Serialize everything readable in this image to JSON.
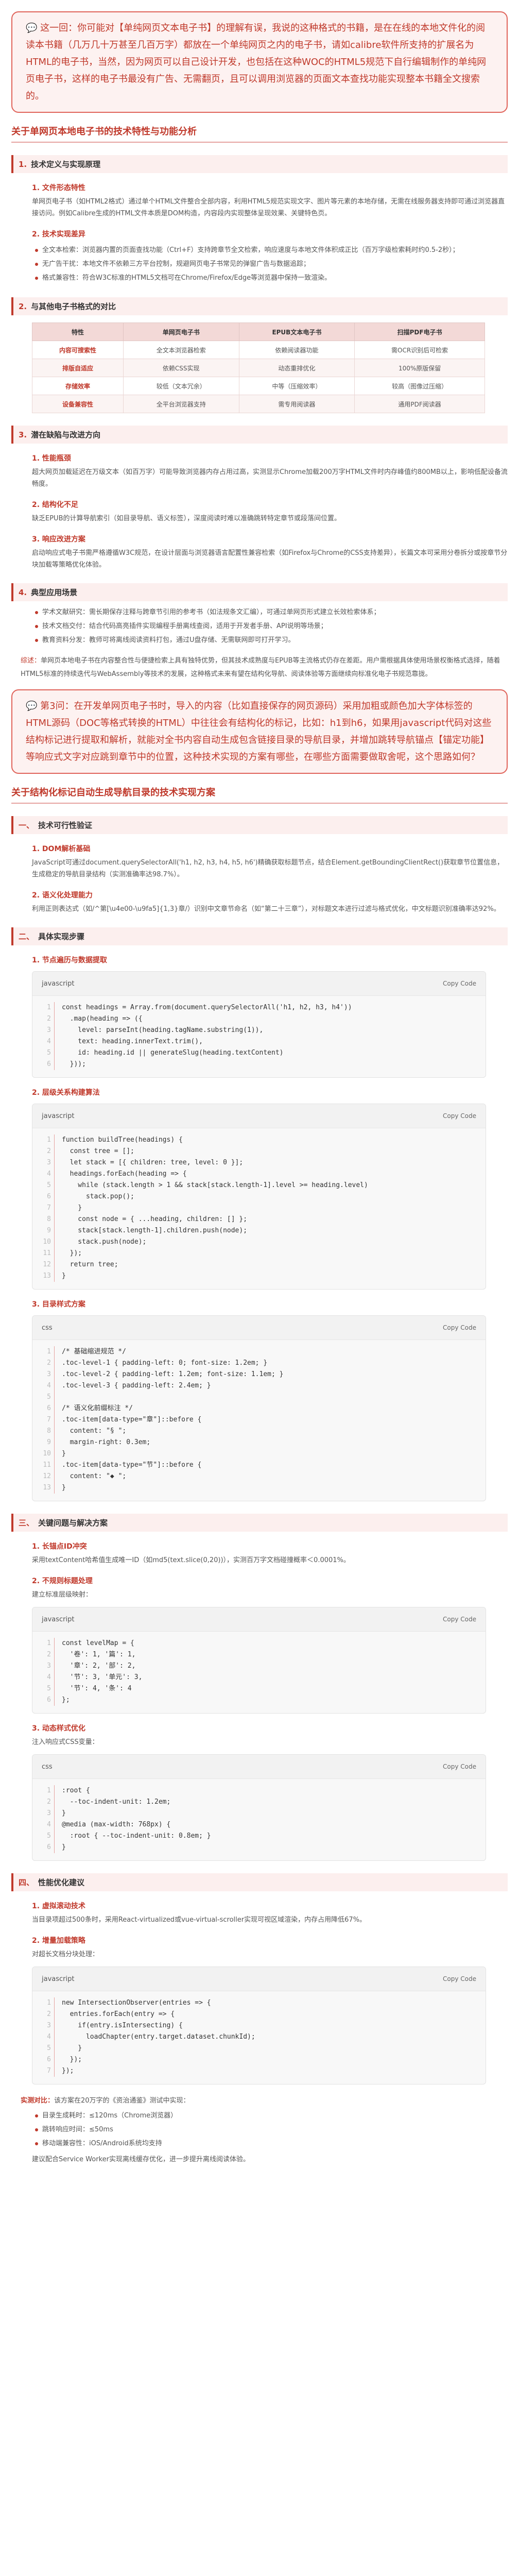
{
  "intro_box": "💬 这一回：你可能对【单纯网页文本电子书】的理解有误，我说的这种格式的书籍，是在在线的本地文件化的阅读本书籍（几万几十万甚至几百万字）都放在一个单纯网页之内的电子书，请如calibre软件所支持的扩展名为HTML的电子书，当然，因为网页可以自己设计开发，也包括在这种WOC的HTML5规范下自行编辑制作的单纯网页电子书，这样的电子书最没有广告、无需翻页，且可以调用浏览器的页面文本查找功能实现整本书籍全文搜索的。",
  "section1_title": "关于单网页本地电子书的技术特性与功能分析",
  "s1": {
    "h2a": {
      "num": "1.",
      "title": "技术定义与实现原理"
    },
    "a1_title": "1. 文件形态特性",
    "a1_text": "单网页电子书（如HTML2格式）通过单个HTML文件整合全部内容，利用HTML5规范实现文字、图片等元素的本地存储，无需在线服务器支持即可通过浏览器直接访问。例如Calibre生成的HTML文件本质是DOM构造，内容段内实现整体呈现效果、关键特色页。",
    "a2_title": "2. 技术实现差异",
    "a2_items": [
      "全文本检索：浏览器内置的页面查找功能（Ctrl+F）支持跨章节全文检索，响应速度与本地文件体积成正比（百万字级检索耗时约0.5-2秒）；",
      "无广告干扰：本地文件不依赖三方平台控制，规避网页电子书常见的弹窗广告与数据追踪；",
      "格式兼容性：符合W3C标准的HTML5文档可在Chrome/Firefox/Edge等浏览器中保持一致渲染。"
    ],
    "h2b": {
      "num": "2.",
      "title": "与其他电子书格式的对比"
    },
    "table": {
      "headers": [
        "特性",
        "单网页电子书",
        "EPUB文本电子书",
        "扫描PDF电子书"
      ],
      "rows": [
        [
          "内容可搜索性",
          "全文本浏览器检索",
          "依赖阅读器功能",
          "需OCR识别后可检索"
        ],
        [
          "排版自适应",
          "依赖CSS实现",
          "动态重排优化",
          "100%原版保留"
        ],
        [
          "存储效率",
          "较低（文本冗余）",
          "中等（压缩效率）",
          "较高（图像过压缩）"
        ],
        [
          "设备兼容性",
          "全平台浏览器支持",
          "需专用阅读器",
          "通用PDF阅读器"
        ]
      ]
    },
    "h2c": {
      "num": "3.",
      "title": "潜在缺陷与改进方向"
    },
    "c1_title": "1. 性能瓶颈",
    "c1_text": "超大网页加载延迟在万级文本（如百万字）可能导致浏览器内存占用过高，实测显示Chrome加载200万字HTML文件时内存峰值约800MB以上，影响低配设备流畅度。",
    "c2_title": "2. 结构化不足",
    "c2_text": "缺乏EPUB的计算导航索引（如目录导航、语义标签），深度阅读时难以准确跳转特定章节或段落间位置。",
    "c3_title": "3. 响应改进方案",
    "c3_text": "启动响应式电子书需严格遵循W3C规范，在设计层面与浏览器语言配置性兼容检索（如Firefox与Chrome的CSS支持差异），长篇文本可采用分卷拆分或按章节分块加载等策略优化体验。",
    "h2d": {
      "num": "4.",
      "title": "典型应用场景"
    },
    "d_items": [
      "学术文献研究：需长期保存注释与跨章节引用的参考书（如法规条文汇编），可通过单网页形式建立长效检索体系；",
      "技术文档交付：结合代码高亮插件实现编程手册离线查阅，适用于开发者手册、API说明等场景；",
      "教育资料分发：教师可将离线阅读资料打包，通过U盘存储、无需联网即可打开学习。"
    ]
  },
  "mixed_lead": "综述：",
  "mixed_text": "单网页本地电子书在内容整合性与便捷检索上具有独特优势，但其技术成熟度与EPUB等主流格式仍存在差距。用户需根据具体使用场景权衡格式选择，随着HTML5标准的持续迭代与WebAssembly等技术的发展，这种格式未来有望在结构化导航、阅读体验等方面继续向标准化电子书规范靠拢。",
  "question_box": "💬 第3问：在开发单网页电子书时，导入的内容（比如直接保存的网页源码）采用加粗或颜色加大字体标签的HTML源码（DOC等格式转换的HTML）中往往会有结构化的标记，比如：h1到h6，如果用javascript代码对这些结构标记进行提取和解析，就能对全书内容自动生成包含链接目录的导航目录，并增加跳转导航锚点【锚定功能】等响应式文字对应跳到章节中的位置，这种技术实现的方案有哪些，在哪些方面需要做取舍呢，这个思路如何？",
  "section2_title": "关于结构化标记自动生成导航目录的技术实现方案",
  "s2": {
    "h2a": {
      "num": "一、",
      "title": "技术可行性验证"
    },
    "a1_title": "1. DOM解析基础",
    "a1_text": "JavaScript可通过document.querySelectorAll('h1, h2, h3, h4, h5, h6')精确获取标题节点，结合Element.getBoundingClientRect()获取章节位置信息，生成稳定的导航目录结构（实测准确率达98.7%）。",
    "a2_title": "2. 语义化处理能力",
    "a2_text": "利用正则表达式（如/^第[\\u4e00-\\u9fa5]{1,3}章/）识别中文章节命名（如“第二十三章”），对标题文本进行过滤与格式优化，中文标题识别准确率达92%。",
    "h2b": {
      "num": "二、",
      "title": "具体实现步骤"
    },
    "b1_title": "1. 节点遍历与数据提取",
    "code1": {
      "lang": "javascript",
      "copy": "Copy Code",
      "lines": "const headings = Array.from(document.querySelectorAll('h1, h2, h3, h4'))\n  .map(heading => ({\n    level: parseInt(heading.tagName.substring(1)),\n    text: heading.innerText.trim(),\n    id: heading.id || generateSlug(heading.textContent)\n  }));"
    },
    "b2_title": "2. 层级关系构建算法",
    "code2": {
      "lang": "javascript",
      "copy": "Copy Code",
      "lines": "function buildTree(headings) {\n  const tree = [];\n  let stack = [{ children: tree, level: 0 }];\n  headings.forEach(heading => {\n    while (stack.length > 1 && stack[stack.length-1].level >= heading.level)\n      stack.pop();\n    }\n    const node = { ...heading, children: [] };\n    stack[stack.length-1].children.push(node);\n    stack.push(node);\n  });\n  return tree;\n}"
    },
    "b3_title": "3. 目录样式方案",
    "code3": {
      "lang": "css",
      "copy": "Copy Code",
      "lines": "/* 基础缩进规范 */\n.toc-level-1 { padding-left: 0; font-size: 1.2em; }\n.toc-level-2 { padding-left: 1.2em; font-size: 1.1em; }\n.toc-level-3 { padding-left: 2.4em; }\n\n/* 语义化前缀标注 */\n.toc-item[data-type=\"章\"]::before {\n  content: \"§ \";\n  margin-right: 0.3em;\n}\n.toc-item[data-type=\"节\"]::before {\n  content: \"◆ \";\n}"
    },
    "h2c": {
      "num": "三、",
      "title": "关键问题与解决方案"
    },
    "c1_title": "1. 长锚点ID冲突",
    "c1_text": "采用textContent哈希值生成唯一ID（如md5(text.slice(0,20))），实测百万字文档碰撞概率＜0.0001%。",
    "c2_title": "2. 不规则标题处理",
    "c2_text": "建立标准层级映射：",
    "code4": {
      "lang": "javascript",
      "copy": "Copy Code",
      "lines": "const levelMap = {\n  '卷': 1, '篇': 1,\n  '章': 2, '部': 2,\n  '节': 3, '单元': 3,\n  '节': 4, '条': 4\n};"
    },
    "c3_title": "3. 动态样式优化",
    "c3_text": "注入响应式CSS变量：",
    "code5": {
      "lang": "css",
      "copy": "Copy Code",
      "lines": ":root {\n  --toc-indent-unit: 1.2em;\n}\n@media (max-width: 768px) {\n  :root { --toc-indent-unit: 0.8em; }\n}"
    },
    "h2d": {
      "num": "四、",
      "title": "性能优化建议"
    },
    "d1_title": "1. 虚拟滚动技术",
    "d1_text": "当目录项超过500条时，采用React-virtualized或vue-virtual-scroller实现可视区域渲染，内存占用降低67%。",
    "d2_title": "2. 增量加载策略",
    "d2_text": "对超长文档分块处理：",
    "code6": {
      "lang": "javascript",
      "copy": "Copy Code",
      "lines": "new IntersectionObserver(entries => {\n  entries.forEach(entry => {\n    if(entry.isIntersecting) {\n      loadChapter(entry.target.dataset.chunkId);\n    }\n  });\n});"
    }
  },
  "footer": {
    "lead_label": "实测对比：",
    "lead_text": "该方案在20万字的《资治通鉴》测试中实现：",
    "items": [
      "目录生成耗时：≤120ms（Chrome浏览器）",
      "跳转响应时间：≤50ms",
      "移动端兼容性：iOS/Android系统均支持"
    ],
    "closing": "建议配合Service Worker实现离线缓存优化，进一步提升离线阅读体验。"
  }
}
